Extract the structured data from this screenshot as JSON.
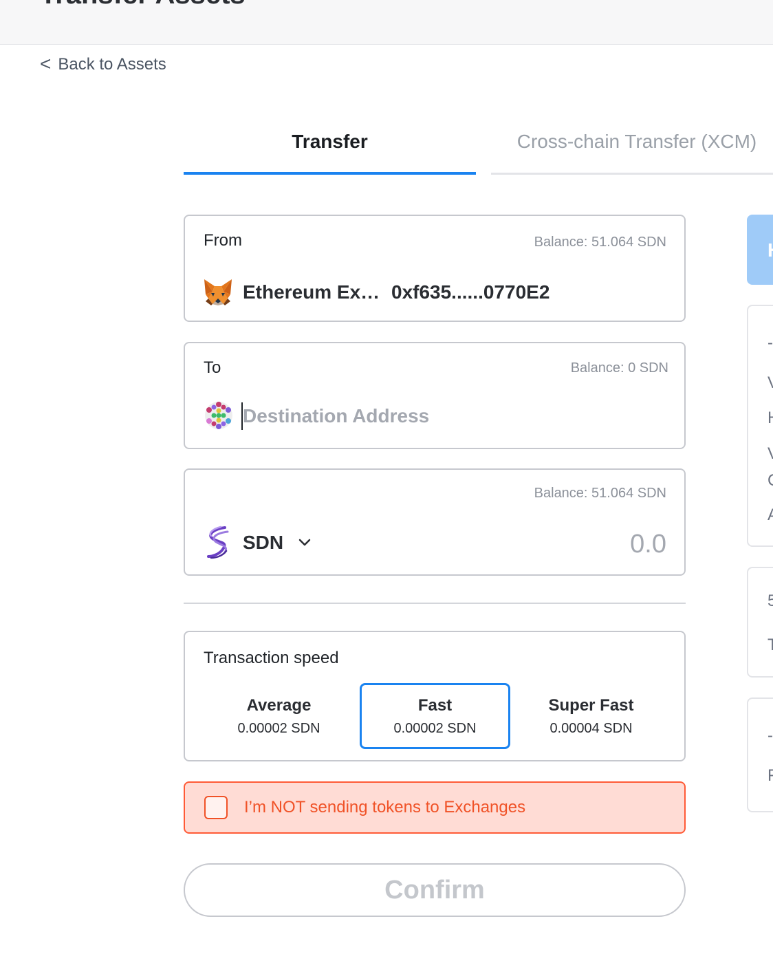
{
  "header": {
    "title": "Transfer Assets"
  },
  "nav": {
    "back_label": "Back to Assets",
    "back_chevron": "<"
  },
  "tabs": [
    {
      "label": "Transfer",
      "active": true
    },
    {
      "label": "Cross-chain Transfer (XCM)",
      "active": false
    }
  ],
  "from": {
    "label": "From",
    "balance": "Balance: 51.064 SDN",
    "wallet_icon": "metamask-fox-icon",
    "account_name": "Ethereum Extension",
    "address": "0xf635......0770E2"
  },
  "to": {
    "label": "To",
    "balance": "Balance: 0 SDN",
    "identicon": "polkadot-identicon",
    "placeholder": "Destination Address",
    "value": ""
  },
  "amount": {
    "balance": "Balance: 51.064 SDN",
    "token_icon": "shiden-sdn-icon",
    "token": "SDN",
    "placeholder": "0.0",
    "value": ""
  },
  "speed": {
    "label": "Transaction speed",
    "options": [
      {
        "name": "Average",
        "fee": "0.00002 SDN",
        "selected": false
      },
      {
        "name": "Fast",
        "fee": "0.00002 SDN",
        "selected": true
      },
      {
        "name": "Super Fast",
        "fee": "0.00004 SDN",
        "selected": false
      }
    ]
  },
  "warning": {
    "text": "I’m NOT sending tokens to Exchanges",
    "checked": false
  },
  "confirm": {
    "label": "Confirm"
  },
  "side": {
    "button_letter": "H",
    "panel1_glyphs": [
      "-",
      "V",
      "H",
      "V",
      "C",
      "A"
    ],
    "panel2_glyphs": [
      "5",
      "T"
    ],
    "panel3_glyphs": [
      "-",
      "F"
    ]
  },
  "colors": {
    "accent": "#1a83f0",
    "warning": "#f05227",
    "warning_bg": "#ffdcd5",
    "muted": "#8b9099"
  }
}
